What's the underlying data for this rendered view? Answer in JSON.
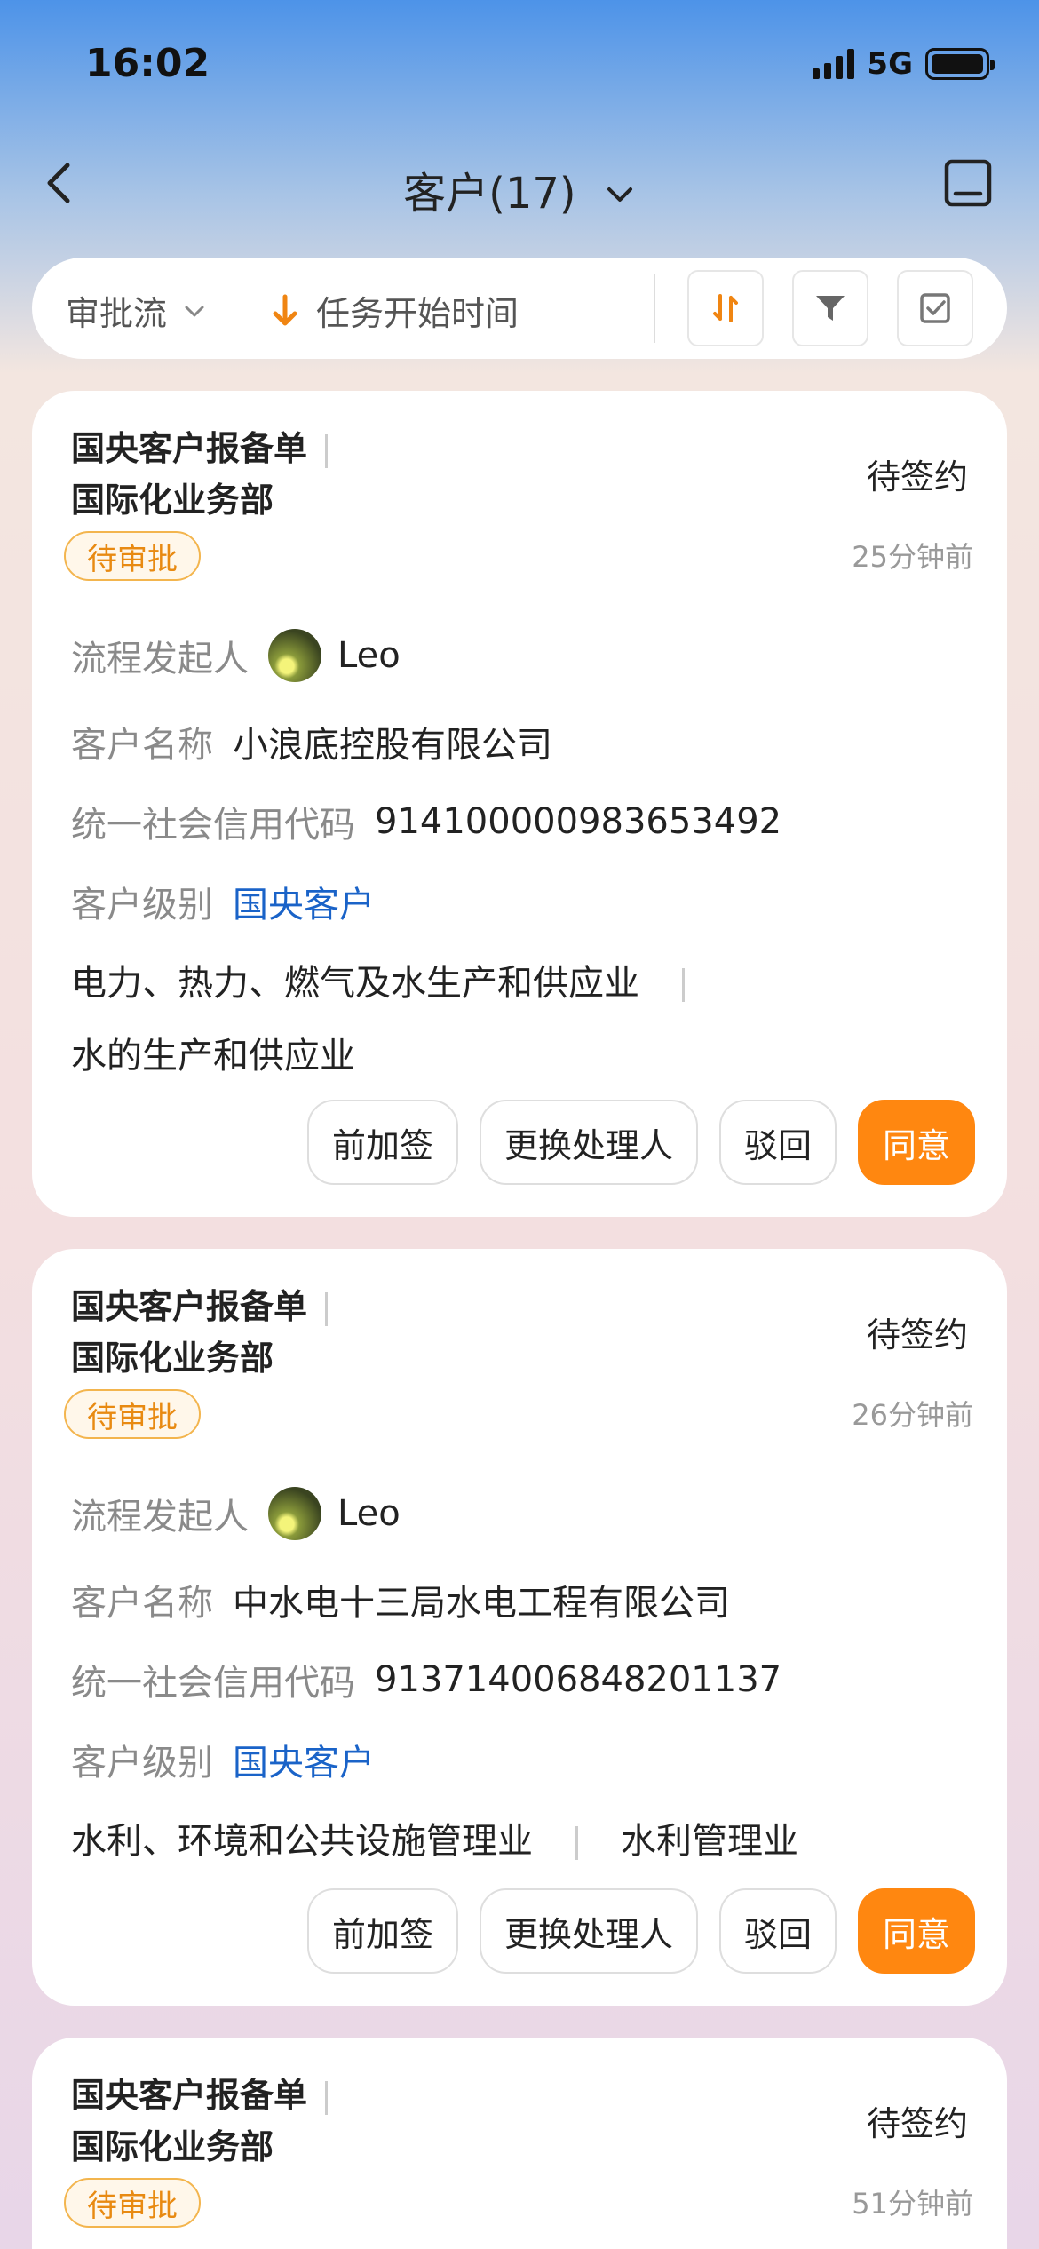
{
  "status_bar": {
    "time": "16:02",
    "network": "5G"
  },
  "nav": {
    "title": "客户(17)"
  },
  "toolbar": {
    "flow_label": "审批流",
    "sort_label": "任务开始时间"
  },
  "cards": [
    {
      "title_line1": "国央客户报备单",
      "title_line2": "国际化业务部",
      "status": "待签约",
      "badge": "待审批",
      "time_ago": "25分钟前",
      "initiator_label": "流程发起人",
      "initiator": "Leo",
      "customer_name_label": "客户名称",
      "customer_name": "小浪底控股有限公司",
      "credit_code_label": "统一社会信用代码",
      "credit_code": "914100000983653492",
      "level_label": "客户级别",
      "level": "国央客户",
      "industry_1": "电力、热力、燃气及水生产和供应业",
      "industry_2": "水的生产和供应业",
      "actions": {
        "add_sign": "前加签",
        "change_handler": "更换处理人",
        "reject": "驳回",
        "approve": "同意"
      }
    },
    {
      "title_line1": "国央客户报备单",
      "title_line2": "国际化业务部",
      "status": "待签约",
      "badge": "待审批",
      "time_ago": "26分钟前",
      "initiator_label": "流程发起人",
      "initiator": "Leo",
      "customer_name_label": "客户名称",
      "customer_name": "中水电十三局水电工程有限公司",
      "credit_code_label": "统一社会信用代码",
      "credit_code": "913714006848201137",
      "level_label": "客户级别",
      "level": "国央客户",
      "industry_1": "水利、环境和公共设施管理业",
      "industry_2": "水利管理业",
      "actions": {
        "add_sign": "前加签",
        "change_handler": "更换处理人",
        "reject": "驳回",
        "approve": "同意"
      }
    },
    {
      "title_line1": "国央客户报备单",
      "title_line2": "国际化业务部",
      "status": "待签约",
      "badge": "待审批",
      "time_ago": "51分钟前"
    }
  ],
  "colors": {
    "accent": "#ff8710",
    "badge": "#e88a12",
    "link": "#1a63c8"
  }
}
